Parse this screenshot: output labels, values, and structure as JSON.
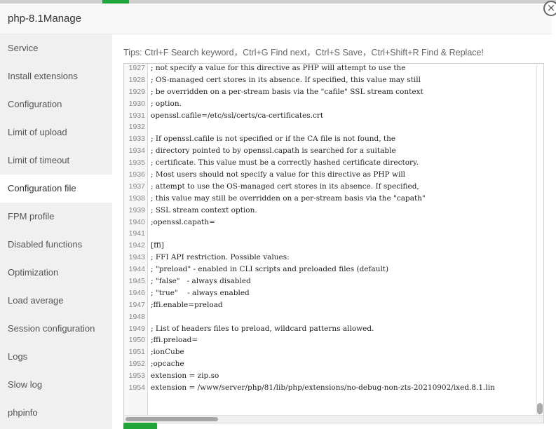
{
  "window": {
    "title": "php-8.1Manage"
  },
  "close_icon": "×",
  "sidebar": {
    "items": [
      {
        "label": "Service"
      },
      {
        "label": "Install extensions"
      },
      {
        "label": "Configuration"
      },
      {
        "label": "Limit of upload"
      },
      {
        "label": "Limit of timeout"
      },
      {
        "label": "Configuration file",
        "active": true
      },
      {
        "label": "FPM profile"
      },
      {
        "label": "Disabled functions"
      },
      {
        "label": "Optimization"
      },
      {
        "label": "Load average"
      },
      {
        "label": "Session configuration"
      },
      {
        "label": "Logs"
      },
      {
        "label": "Slow log"
      },
      {
        "label": "phpinfo"
      }
    ]
  },
  "tips": "Tips:  Ctrl+F Search keyword，Ctrl+G Find next，Ctrl+S Save，Ctrl+Shift+R Find & Replace!",
  "editor": {
    "lines": [
      {
        "n": "1927",
        "t": "; not specify a value for this directive as PHP will attempt to use the"
      },
      {
        "n": "1928",
        "t": "; OS-managed cert stores in its absence. If specified, this value may still"
      },
      {
        "n": "1929",
        "t": "; be overridden on a per-stream basis via the \"cafile\" SSL stream context"
      },
      {
        "n": "1930",
        "t": "; option."
      },
      {
        "n": "1931",
        "t": "openssl.cafile=/etc/ssl/certs/ca-certificates.crt"
      },
      {
        "n": "1932",
        "t": ""
      },
      {
        "n": "1933",
        "t": "; If openssl.cafile is not specified or if the CA file is not found, the"
      },
      {
        "n": "1934",
        "t": "; directory pointed to by openssl.capath is searched for a suitable"
      },
      {
        "n": "1935",
        "t": "; certificate. This value must be a correctly hashed certificate directory."
      },
      {
        "n": "1936",
        "t": "; Most users should not specify a value for this directive as PHP will"
      },
      {
        "n": "1937",
        "t": "; attempt to use the OS-managed cert stores in its absence. If specified,"
      },
      {
        "n": "1938",
        "t": "; this value may still be overridden on a per-stream basis via the \"capath\""
      },
      {
        "n": "1939",
        "t": "; SSL stream context option."
      },
      {
        "n": "1940",
        "t": ";openssl.capath="
      },
      {
        "n": "1941",
        "t": ""
      },
      {
        "n": "1942",
        "t": "[ffi]"
      },
      {
        "n": "1943",
        "t": "; FFI API restriction. Possible values:"
      },
      {
        "n": "1944",
        "t": "; \"preload\" - enabled in CLI scripts and preloaded files (default)"
      },
      {
        "n": "1945",
        "t": "; \"false\"   - always disabled"
      },
      {
        "n": "1946",
        "t": "; \"true\"    - always enabled"
      },
      {
        "n": "1947",
        "t": ";ffi.enable=preload"
      },
      {
        "n": "1948",
        "t": ""
      },
      {
        "n": "1949",
        "t": "; List of headers files to preload, wildcard patterns allowed."
      },
      {
        "n": "1950",
        "t": ";ffi.preload="
      },
      {
        "n": "1951",
        "t": ";ionCube"
      },
      {
        "n": "1952",
        "t": ";opcache"
      },
      {
        "n": "1953",
        "t": "extension = zip.so"
      },
      {
        "n": "1954",
        "t": "extension = /www/server/php/81/lib/php/extensions/no-debug-non-zts-20210902/ixed.8.1.lin"
      }
    ]
  },
  "colors": {
    "accent": "#20a53a",
    "sidebar_bg": "#f0f0f0"
  }
}
